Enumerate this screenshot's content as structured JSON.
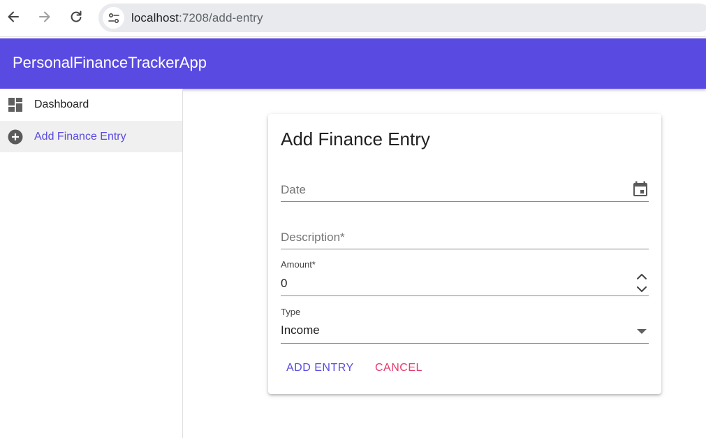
{
  "browser": {
    "url_host": "localhost",
    "url_path": ":7208/add-entry",
    "back_icon": "arrow-left-icon",
    "forward_icon": "arrow-right-icon",
    "reload_icon": "reload-icon",
    "site_info_icon": "tune-icon"
  },
  "app": {
    "title": "PersonalFinanceTrackerApp",
    "accent_color": "#594ae2"
  },
  "sidebar": {
    "items": [
      {
        "label": "Dashboard",
        "icon": "dashboard-icon",
        "active": false
      },
      {
        "label": "Add Finance Entry",
        "icon": "add-circle-icon",
        "active": true
      }
    ]
  },
  "form": {
    "title": "Add Finance Entry",
    "date": {
      "placeholder": "Date",
      "value": "",
      "icon": "calendar-icon"
    },
    "description": {
      "placeholder": "Description*",
      "value": ""
    },
    "amount": {
      "label": "Amount*",
      "value": "0",
      "icon": "stepper-icon"
    },
    "type": {
      "label": "Type",
      "value": "Income",
      "icon": "dropdown-arrow-icon"
    },
    "submit_label": "Add Entry",
    "cancel_label": "Cancel",
    "submit_color": "#594ae2",
    "cancel_color": "#e5396d"
  }
}
